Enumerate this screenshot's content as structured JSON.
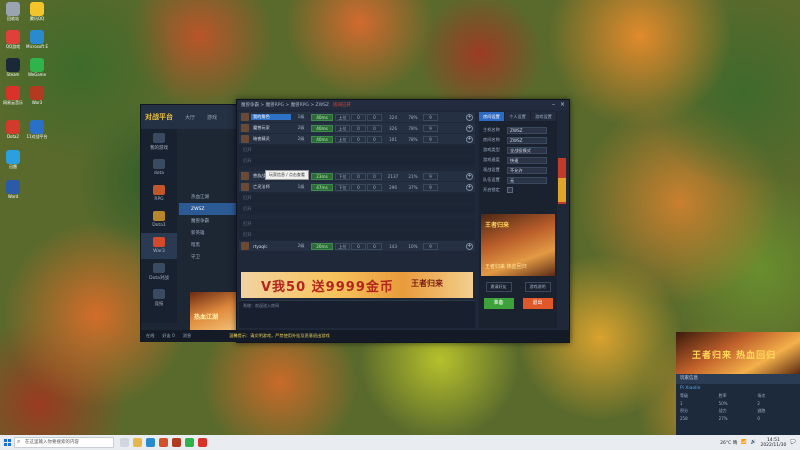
{
  "desktop_icons": [
    {
      "label": "回收站",
      "color": "#9aa4b0"
    },
    {
      "label": "腾讯QQ",
      "color": "#f3c52a"
    },
    {
      "label": "QQ游戏",
      "color": "#e0403a"
    },
    {
      "label": "Microsoft Edge",
      "color": "#2a8ad0"
    },
    {
      "label": "Steam",
      "color": "#1b2838"
    },
    {
      "label": "WeGame",
      "color": "#2fb34a"
    },
    {
      "label": "网易云音乐",
      "color": "#d9322a"
    },
    {
      "label": "War3",
      "color": "#b23a1e"
    },
    {
      "label": "Dota2",
      "color": "#d23a2a"
    },
    {
      "label": "11对战平台",
      "color": "#2a70c8"
    },
    {
      "label": "迅雷",
      "color": "#2aa0e0"
    },
    {
      "label": "Word",
      "color": "#2a5aa8"
    }
  ],
  "launcher": {
    "logo": "对战平台",
    "tabs": [
      "大厅",
      "游戏"
    ],
    "side_items": [
      "我的游戏",
      "dota",
      "RPG",
      "Dota1",
      "War3",
      "Dota对战",
      "竞技"
    ],
    "games": [
      "热血江湖",
      "ZWSZ",
      "魔兽争霸",
      "新英雄",
      "暗黑",
      "守卫"
    ],
    "footer": [
      "在线",
      "好友",
      "消息"
    ]
  },
  "room": {
    "title": "魔兽争霸 > 魔兽RPG > 魔兽RPG > ZWSZ",
    "title_highlight": "房间已开",
    "slots_team1": [
      {
        "name": "我的角色",
        "level": "1级",
        "ping": "40ms",
        "state": "上位",
        "a": "0",
        "b": "0",
        "num": "324",
        "pct": "78%",
        "score": "9",
        "me": true
      },
      {
        "name": "魔兽玩家",
        "level": "2级",
        "ping": "40ms",
        "state": "上位",
        "a": "0",
        "b": "0",
        "num": "326",
        "pct": "78%",
        "score": "9",
        "me": false
      },
      {
        "name": "暗夜精灵",
        "level": "2级",
        "ping": "40ms",
        "state": "上位",
        "a": "0",
        "b": "0",
        "num": "101",
        "pct": "78%",
        "score": "9",
        "me": false
      }
    ],
    "slots_team2": [
      {
        "name": "兽族战士",
        "level": "3级",
        "ping": "23ms",
        "state": "下位",
        "a": "0",
        "b": "0",
        "num": "2137",
        "pct": "21%",
        "score": "9",
        "me": false
      },
      {
        "name": "亡灵法师",
        "level": "1级",
        "ping": "47ms",
        "state": "下位",
        "a": "0",
        "b": "0",
        "num": "296",
        "pct": "37%",
        "score": "9",
        "me": false
      }
    ],
    "empty_slot": "打开",
    "slots_team3": [
      {
        "name": "rtyaqlc",
        "level": "2级",
        "ping": "20ms",
        "state": "上位",
        "a": "0",
        "b": "0",
        "num": "143",
        "pct": "10%",
        "score": "9",
        "me": false
      }
    ],
    "tooltip": "玩家信息 / 点击查看",
    "banner_text": "V我50 送9999金币",
    "banner_logo": "王者归来",
    "chat_line": "系统：欢迎进入房间",
    "input_hint": "按回车键发送消息",
    "input_notice": "发送"
  },
  "right_panel": {
    "tabs": [
      "房间设置",
      "个人设置",
      "游戏设置"
    ],
    "rows": [
      {
        "k": "主机名称",
        "v": "ZWSZ"
      },
      {
        "k": "房间名称",
        "v": "ZWSZ"
      },
      {
        "k": "游戏类型",
        "v": "全战役模式"
      },
      {
        "k": "游戏速度",
        "v": "快速"
      },
      {
        "k": "观战设置",
        "v": "不允许"
      },
      {
        "k": "队伍设置",
        "v": "无"
      }
    ],
    "checkbox_label": "开启锁定",
    "ad_title": "王者归来",
    "ad_sub": "王者归来 热血回归",
    "small_btn_1": "邀请好友",
    "small_btn_2": "游戏说明",
    "ready_label": "准备",
    "exit_label": "退出"
  },
  "status_bar": {
    "items": [
      "在线",
      "好友 0",
      "消息"
    ],
    "notice": "温馨提示：请文明游戏，严禁使用外挂及恶意退出游戏"
  },
  "left_ad": {
    "text": "热血江湖"
  },
  "popup": {
    "ad_text": "王者归来 热血回归",
    "header": "玩家信息",
    "name": "Pi Xiaolin",
    "grid": [
      "等级",
      "胜率",
      "场次",
      "1",
      "50%",
      "2",
      "积分",
      "战力",
      "逃跑",
      "258",
      "27%",
      "0"
    ]
  },
  "taskbar": {
    "search_placeholder": "在这里输入你要搜索的内容",
    "tray_text": "26°C 晴",
    "time": "14:51",
    "date": "2022/11/30"
  }
}
